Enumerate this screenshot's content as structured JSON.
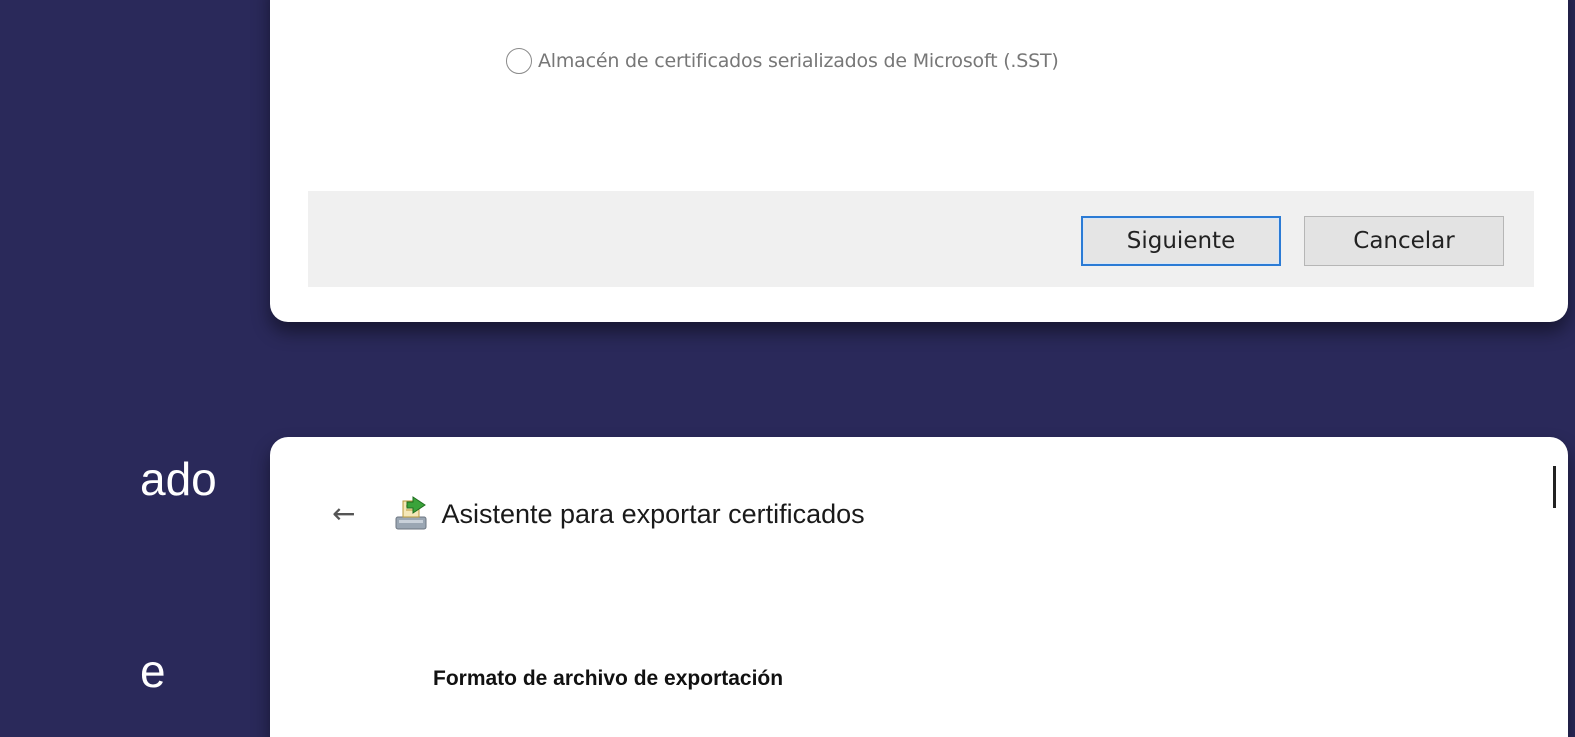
{
  "background": {
    "color": "#2a295a",
    "side_text": [
      "ado",
      "e"
    ]
  },
  "top_dialog": {
    "radio_option": {
      "label": "Almacén de certificados serializados de Microsoft (.SST)",
      "selected": false
    },
    "buttons": {
      "next_label": "Siguiente",
      "cancel_label": "Cancelar"
    },
    "accent_color": "#2b7bd5"
  },
  "bottom_dialog": {
    "back_icon": "back-arrow-icon",
    "wizard_icon": "certificate-export-icon",
    "title": "Asistente para exportar certificados",
    "section_heading": "Formato de archivo de exportación"
  }
}
